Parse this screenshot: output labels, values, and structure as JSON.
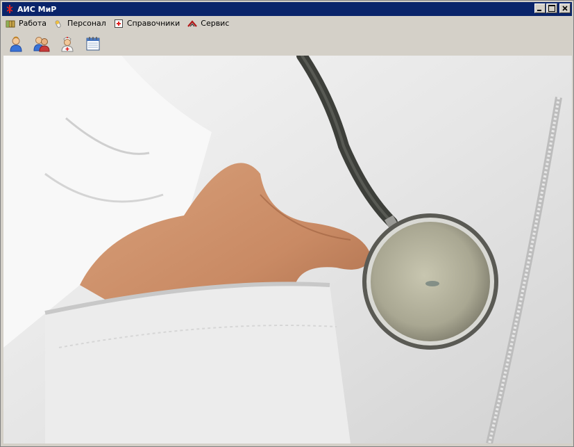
{
  "window": {
    "title": "АИС МиР"
  },
  "menu": {
    "items": [
      {
        "label": "Работа",
        "icon": "map-icon"
      },
      {
        "label": "Персонал",
        "icon": "pill-icon"
      },
      {
        "label": "Справочники",
        "icon": "first-aid-book-icon"
      },
      {
        "label": "Сервис",
        "icon": "tools-icon"
      }
    ]
  },
  "toolbar": {
    "buttons": [
      {
        "icon": "patient-icon"
      },
      {
        "icon": "staff-group-icon"
      },
      {
        "icon": "nurse-icon"
      },
      {
        "icon": "calendar-icon"
      }
    ]
  },
  "content": {
    "image": "doctor-coat-stethoscope"
  }
}
